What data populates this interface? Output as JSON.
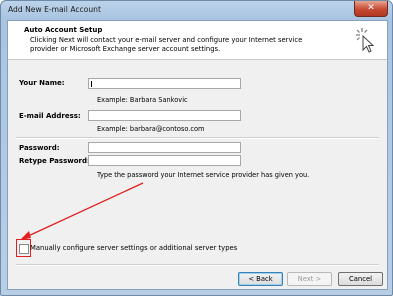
{
  "window": {
    "title": "Add New E-mail Account",
    "close_glyph": "✕"
  },
  "header": {
    "title": "Auto Account Setup",
    "description": "Clicking Next will contact your e-mail server and configure your Internet service provider or Microsoft Exchange server account settings.",
    "icon": "wizard-cursor-icon"
  },
  "form": {
    "name_label": "Your Name:",
    "name_value": "",
    "name_example": "Example: Barbara Sankovic",
    "email_label": "E-mail Address:",
    "email_value": "",
    "email_example": "Example: barbara@contoso.com",
    "password_label": "Password:",
    "password_value": "",
    "retype_label": "Retype Password:",
    "retype_value": "",
    "password_hint": "Type the password your Internet service provider has given you."
  },
  "manual_config": {
    "label": "Manually configure server settings or additional server types",
    "checked": false
  },
  "annotation": {
    "color": "#e02020"
  },
  "buttons": {
    "back": "< Back",
    "next": "Next >",
    "cancel": "Cancel"
  }
}
